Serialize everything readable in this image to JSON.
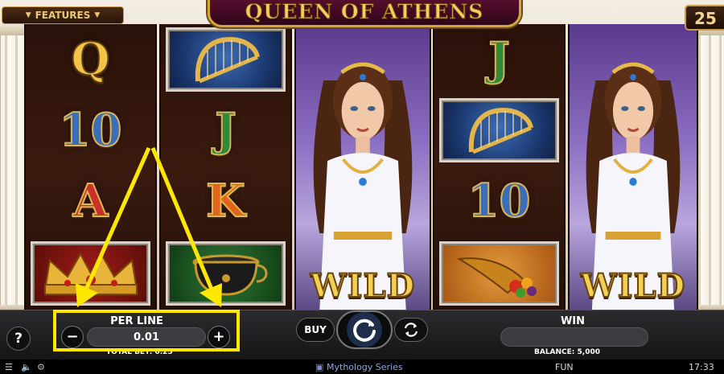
{
  "game": {
    "title": "QUEEN OF ATHENS",
    "features_label": "FEATURES",
    "lines": "25"
  },
  "reels": [
    {
      "symbols": [
        {
          "type": "letter",
          "text": "Q",
          "color": "gold"
        },
        {
          "type": "letter",
          "text": "10",
          "color": "blue"
        },
        {
          "type": "letter",
          "text": "A",
          "color": "red"
        },
        {
          "type": "tile",
          "icon": "crown-icon"
        }
      ]
    },
    {
      "symbols": [
        {
          "type": "tile",
          "icon": "harp-icon"
        },
        {
          "type": "letter",
          "text": "J",
          "color": "green"
        },
        {
          "type": "letter",
          "text": "K",
          "color": "orange"
        },
        {
          "type": "tile",
          "icon": "cauldron-icon"
        }
      ]
    },
    {
      "wild": "WILD",
      "icon": "queen-icon"
    },
    {
      "symbols": [
        {
          "type": "letter",
          "text": "J",
          "color": "green"
        },
        {
          "type": "tile",
          "icon": "harp-icon"
        },
        {
          "type": "letter",
          "text": "10",
          "color": "blue"
        },
        {
          "type": "tile",
          "icon": "cornucopia-icon"
        }
      ]
    },
    {
      "wild": "WILD",
      "icon": "queen-icon"
    }
  ],
  "controls": {
    "help": "?",
    "per_line_label": "PER LINE",
    "per_line_value": "0.01",
    "minus": "−",
    "plus": "+",
    "total_bet": "TOTAL BET: 0.25",
    "buy_label": "BUY",
    "win_label": "WIN",
    "win_value": "",
    "balance": "BALANCE: 5,000"
  },
  "footer": {
    "series": "Mythology Series",
    "mode": "FUN",
    "time": "17:33"
  },
  "colors": {
    "annotation": "#ffe800",
    "gold": "#f3cd5f",
    "title_plate": "#5a0f2f"
  }
}
